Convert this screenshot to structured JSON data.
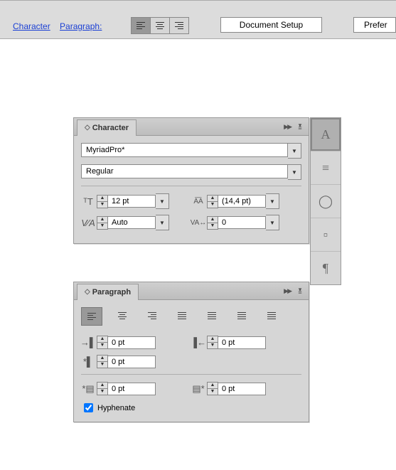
{
  "toolbar": {
    "character_link": "Character",
    "paragraph_link": "Paragraph:",
    "doc_setup": "Document Setup",
    "preferences": "Prefer"
  },
  "character_panel": {
    "title": "Character",
    "font_family": "MyriadPro*",
    "font_style": "Regular",
    "size": "12 pt",
    "leading": "(14,4 pt)",
    "kerning": "Auto",
    "tracking": "0"
  },
  "paragraph_panel": {
    "title": "Paragraph",
    "indent_left": "0 pt",
    "indent_right": "0 pt",
    "indent_first": "0 pt",
    "space_before": "0 pt",
    "space_after": "0 pt",
    "hyphenate_label": "Hyphenate"
  },
  "side": {
    "a": "A",
    "pilcrow": "¶"
  }
}
